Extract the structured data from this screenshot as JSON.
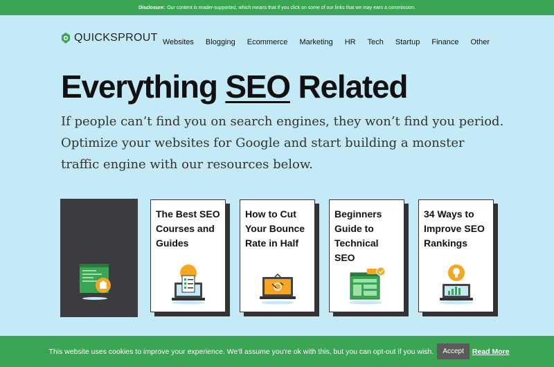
{
  "disclosure": {
    "label": "Disclosure:",
    "text": "Our content is reader-supported, which means that if you click on some of our links that we may earn a commission."
  },
  "logo": {
    "text": "QUICKSPROUT",
    "icon": "sprout-logo-icon",
    "color": "#3aa552"
  },
  "nav": {
    "items": [
      {
        "label": "Websites"
      },
      {
        "label": "Blogging"
      },
      {
        "label": "Ecommerce"
      },
      {
        "label": "Marketing"
      },
      {
        "label": "HR"
      },
      {
        "label": "Tech"
      },
      {
        "label": "Startup"
      },
      {
        "label": "Finance"
      },
      {
        "label": "Other"
      }
    ]
  },
  "hero": {
    "headline_pre": "Everything",
    "headline_seo": "SEO",
    "headline_post": "Related",
    "intro": "If people can’t find you on search engines, they won’t find you period. Optimize your websites for Google and start building a monster traffic engine with our resources below."
  },
  "cards": [
    {
      "title": "The Best SEO Courses and Guides",
      "icon": "checklist-laptop-icon"
    },
    {
      "title": "How to Cut Your Bounce Rate in Half",
      "icon": "bounce-laptop-icon"
    },
    {
      "title": "Beginners Guide to Technical SEO",
      "icon": "www-browser-icon"
    },
    {
      "title": "34 Ways to Improve SEO Rankings",
      "icon": "lightbulb-rankings-icon"
    }
  ],
  "cookie": {
    "text": "This website uses cookies to improve your experience. We'll assume you're ok with this, but you can opt-out if you wish.",
    "accept_label": "Accept",
    "read_more_label": "Read More"
  },
  "colors": {
    "background": "#c3eaf6",
    "brand_green": "#3aa552",
    "accent_orange": "#f6a623",
    "dark_card": "#3b3b40"
  }
}
